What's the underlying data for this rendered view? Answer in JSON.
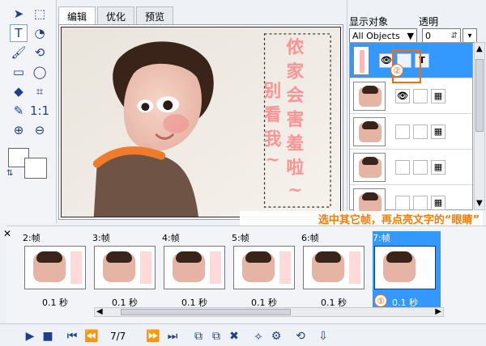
{
  "tabs": [
    "编辑",
    "优化",
    "预览"
  ],
  "canvas": {
    "art_description": "child photo with vertical calligraphy text overlay"
  },
  "right_panel": {
    "display_objects_label": "显示对象",
    "display_objects_value": "All Objects",
    "transparency_label": "透明",
    "transparency_value": "0",
    "marker_2": "②"
  },
  "annotation": {
    "text": "选中其它帧，再点亮文字的“眼睛”"
  },
  "timeline": {
    "frames": [
      {
        "label": "2:帧",
        "duration": "0.1 秒",
        "selected": false
      },
      {
        "label": "3:帧",
        "duration": "0.1 秒",
        "selected": false
      },
      {
        "label": "4:帧",
        "duration": "0.1 秒",
        "selected": false
      },
      {
        "label": "5:帧",
        "duration": "0.1 秒",
        "selected": false
      },
      {
        "label": "6:帧",
        "duration": "0.1 秒",
        "selected": false
      },
      {
        "label": "7:帧",
        "duration": "0.1 秒",
        "selected": true
      }
    ],
    "marker_1": "①",
    "page_counter": "7/7"
  },
  "colors": {
    "selection": "#3399ff",
    "annotation_text": "#ff7a00",
    "marker": "#ff6a00"
  }
}
